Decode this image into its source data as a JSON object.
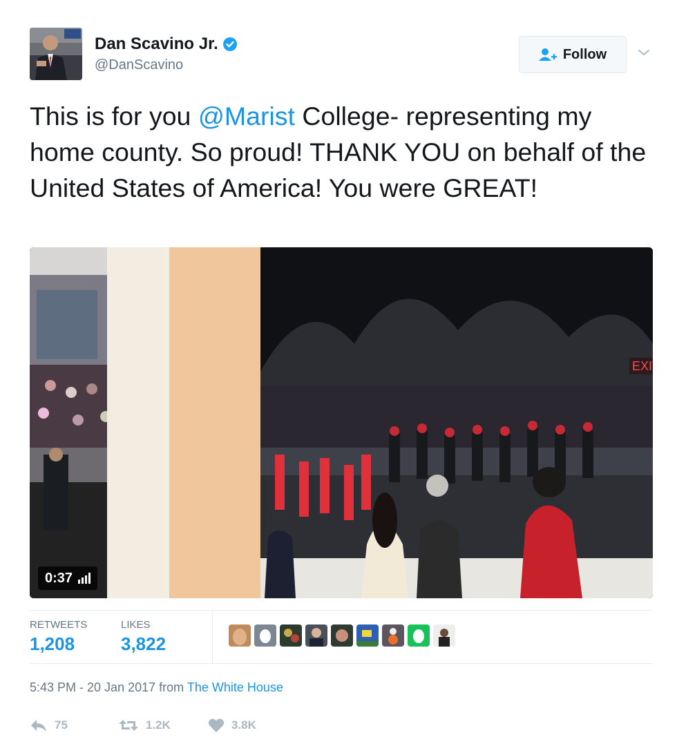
{
  "user": {
    "display_name": "Dan Scavino Jr.",
    "handle": "@DanScavino",
    "verified_icon": "verified-badge-icon"
  },
  "follow": {
    "label": "Follow"
  },
  "tweet": {
    "text_before": "This is for you ",
    "mention": "@Marist",
    "text_after": " College- representing my home county. So proud! THANK YOU on behalf of the United States of America! You were GREAT!"
  },
  "video": {
    "duration": "0:37",
    "sign_text": "EXIT"
  },
  "stats": {
    "retweets_label": "RETWEETS",
    "retweets_value": "1,208",
    "likes_label": "LIKES",
    "likes_value": "3,822"
  },
  "meta": {
    "timestamp": "5:43 PM - 20 Jan 2017",
    "from": "from",
    "source": "The White House"
  },
  "actions": {
    "reply_count": "75",
    "retweet_count": "1.2K",
    "like_count": "3.8K"
  },
  "colors": {
    "link": "#1b95e0",
    "muted": "#657786",
    "action": "#aab8c2"
  }
}
